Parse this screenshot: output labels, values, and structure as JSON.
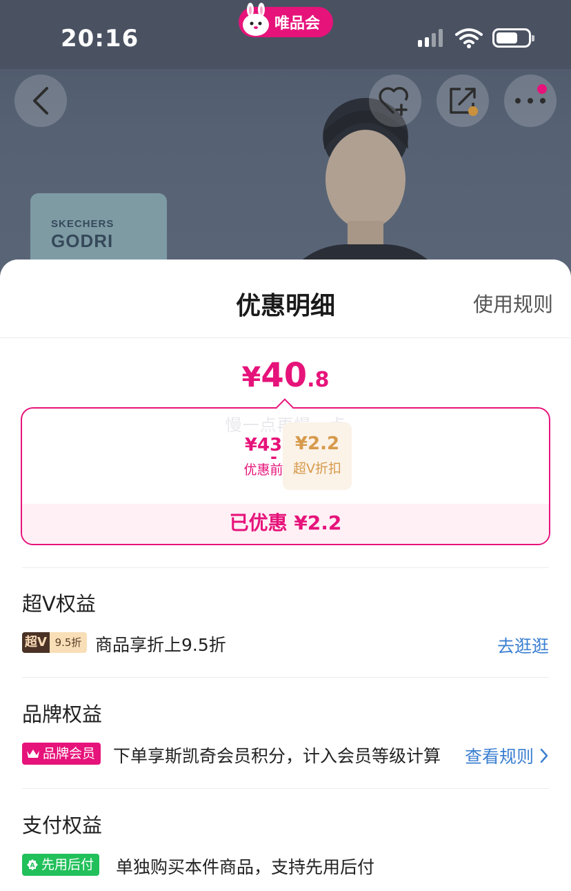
{
  "status_bar": {
    "time": "20:16",
    "app_badge": "唯品会"
  },
  "background": {
    "brand_line1": "SKECHERS",
    "brand_line2": "GODRI"
  },
  "sheet": {
    "title": "优惠明细",
    "rules_link": "使用规则",
    "final_price": {
      "yen": "¥",
      "integer": "40",
      "decimal": ".8"
    },
    "watermark": "慢一点再慢一点",
    "calc": {
      "before_value": "¥43",
      "before_label": "优惠前",
      "operator": "-",
      "discount_value": "¥2.2",
      "discount_label": "超V折扣",
      "saved_text": "已优惠 ¥2.2"
    },
    "sections": {
      "superv": {
        "title": "超V权益",
        "badge_left": "超V",
        "badge_right": "9.5折",
        "text": "商品享折上9.5折",
        "link": "去逛逛"
      },
      "brand": {
        "title": "品牌权益",
        "badge": "品牌会员",
        "text": "下单享斯凯奇会员积分，计入会员等级计算",
        "link": "查看规则"
      },
      "payment": {
        "title": "支付权益",
        "badge": "先用后付",
        "text": "单独购买本件商品，支持先用后付"
      }
    }
  },
  "colors": {
    "accent": "#e6137a",
    "link": "#3b7fd0",
    "gold": "#d69a4a",
    "green": "#22c05b"
  }
}
